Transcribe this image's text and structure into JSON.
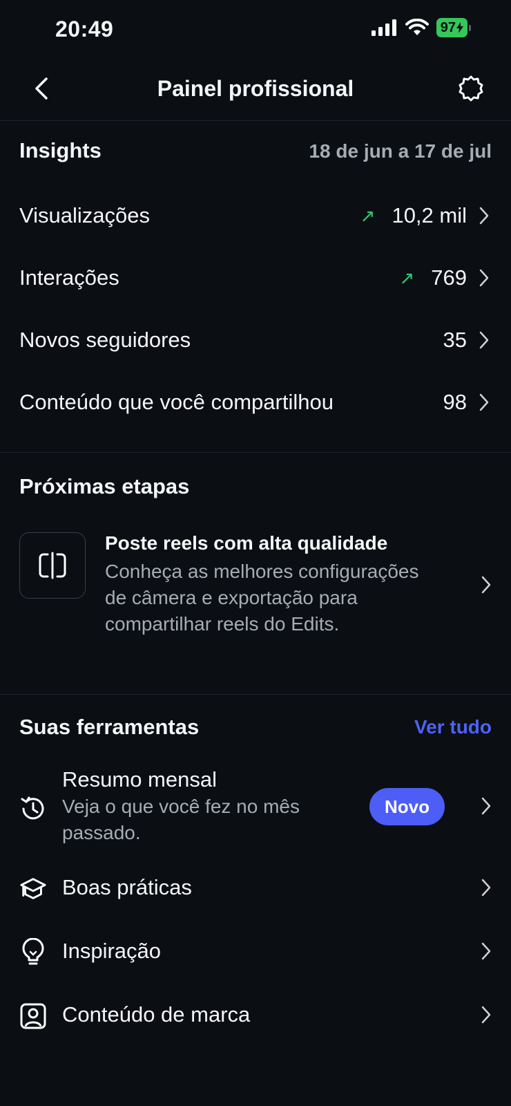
{
  "status_bar": {
    "time": "20:49",
    "battery": "97"
  },
  "header": {
    "title": "Painel profissional"
  },
  "insights": {
    "title": "Insights",
    "date_range": "18 de jun a 17 de jul",
    "rows": [
      {
        "label": "Visualizações",
        "value": "10,2 mil",
        "trend": "↗"
      },
      {
        "label": "Interações",
        "value": "769",
        "trend": "↗"
      },
      {
        "label": "Novos seguidores",
        "value": "35",
        "trend": ""
      },
      {
        "label": "Conteúdo que você compartilhou",
        "value": "98",
        "trend": ""
      }
    ]
  },
  "next_steps": {
    "title": "Próximas etapas",
    "card": {
      "title": "Poste reels com alta qualidade",
      "description": "Conheça as melhores configurações de câmera e exportação para compartilhar reels do Edits."
    }
  },
  "tools": {
    "title": "Suas ferramentas",
    "see_all": "Ver tudo",
    "items": [
      {
        "label": "Resumo mensal",
        "sub": "Veja o que você fez no mês passado.",
        "badge": "Novo",
        "icon": "history-clock-icon"
      },
      {
        "label": "Boas práticas",
        "icon": "graduation-cap-icon"
      },
      {
        "label": "Inspiração",
        "icon": "lightbulb-icon"
      },
      {
        "label": "Conteúdo de marca",
        "icon": "brand-profile-icon"
      }
    ]
  },
  "colors": {
    "background": "#0b0f14",
    "accent": "#4d5ef7",
    "trend_up": "#2ecc71",
    "secondary_text": "#a7acb4"
  }
}
